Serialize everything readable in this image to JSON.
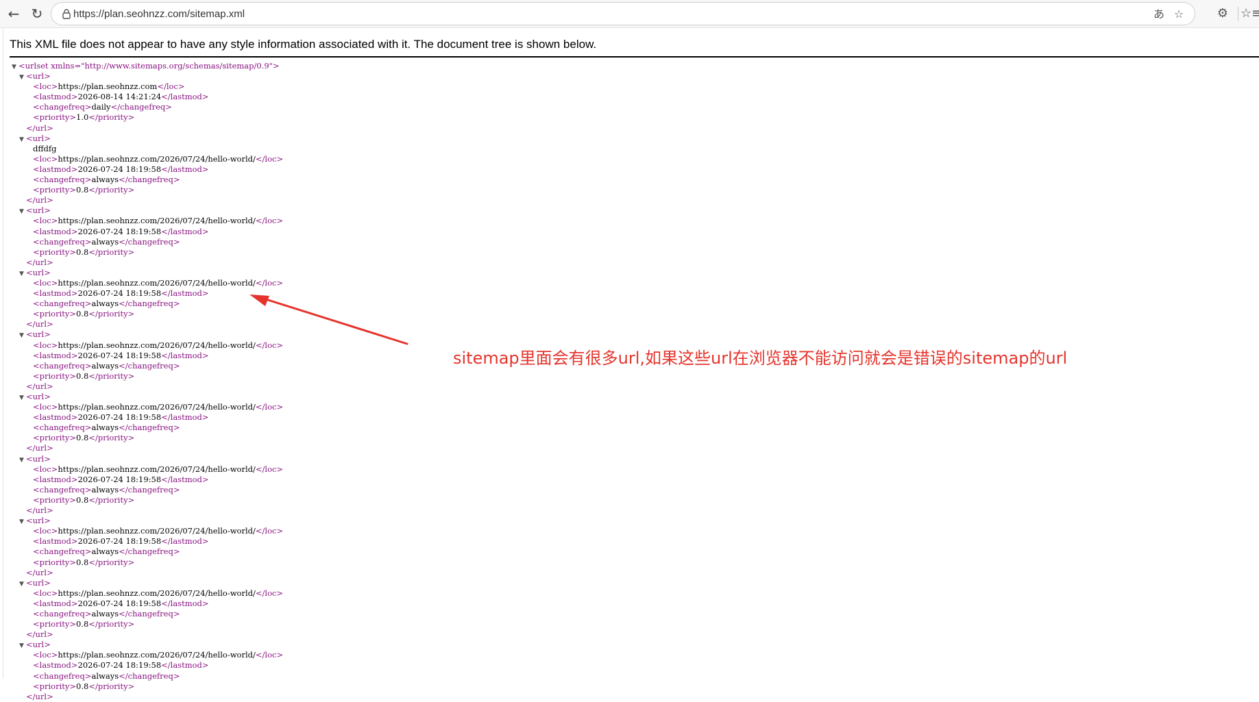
{
  "browser": {
    "url": "https://plan.seohnzz.com/sitemap.xml",
    "back_icon": "←",
    "reload_icon": "↻",
    "translate_icon": "あ",
    "star_icon": "☆",
    "extensions_icon": "⚙",
    "favorites_icon": "☆≡"
  },
  "page": {
    "xml_message": "This XML file does not appear to have any style information associated with it. The document tree is shown below."
  },
  "xml": {
    "urlset_open": "<urlset xmlns=\"http://www.sitemaps.org/schemas/sitemap/0.9\">",
    "url_open": "<url>",
    "url_close": "</url>",
    "entries": [
      {
        "loc": "https://plan.seohnzz.com",
        "lastmod": "2026-08-14 14:21:24",
        "changefreq": "daily",
        "priority": "1.0",
        "stray_text": ""
      },
      {
        "loc": "https://plan.seohnzz.com/2026/07/24/hello-world/",
        "lastmod": "2026-07-24 18:19:58",
        "changefreq": "always",
        "priority": "0.8",
        "stray_text": "dffdfg"
      },
      {
        "loc": "https://plan.seohnzz.com/2026/07/24/hello-world/",
        "lastmod": "2026-07-24 18:19:58",
        "changefreq": "always",
        "priority": "0.8",
        "stray_text": ""
      },
      {
        "loc": "https://plan.seohnzz.com/2026/07/24/hello-world/",
        "lastmod": "2026-07-24 18:19:58",
        "changefreq": "always",
        "priority": "0.8",
        "stray_text": ""
      },
      {
        "loc": "https://plan.seohnzz.com/2026/07/24/hello-world/",
        "lastmod": "2026-07-24 18:19:58",
        "changefreq": "always",
        "priority": "0.8",
        "stray_text": ""
      },
      {
        "loc": "https://plan.seohnzz.com/2026/07/24/hello-world/",
        "lastmod": "2026-07-24 18:19:58",
        "changefreq": "always",
        "priority": "0.8",
        "stray_text": ""
      },
      {
        "loc": "https://plan.seohnzz.com/2026/07/24/hello-world/",
        "lastmod": "2026-07-24 18:19:58",
        "changefreq": "always",
        "priority": "0.8",
        "stray_text": ""
      },
      {
        "loc": "https://plan.seohnzz.com/2026/07/24/hello-world/",
        "lastmod": "2026-07-24 18:19:58",
        "changefreq": "always",
        "priority": "0.8",
        "stray_text": ""
      },
      {
        "loc": "https://plan.seohnzz.com/2026/07/24/hello-world/",
        "lastmod": "2026-07-24 18:19:58",
        "changefreq": "always",
        "priority": "0.8",
        "stray_text": ""
      },
      {
        "loc": "https://plan.seohnzz.com/2026/07/24/hello-world/",
        "lastmod": "2026-07-24 18:19:58",
        "changefreq": "always",
        "priority": "0.8",
        "stray_text": ""
      }
    ]
  },
  "annotation": {
    "text": "sitemap里面会有很多url,如果这些url在浏览器不能访问就会是错误的sitemap的url",
    "color": "#e5342c"
  }
}
